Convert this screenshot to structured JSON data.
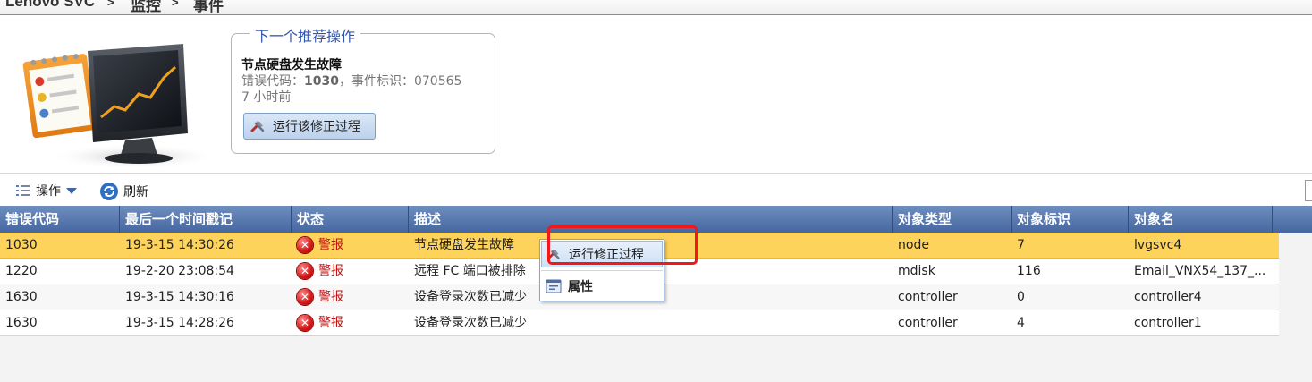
{
  "breadcrumb": {
    "items": [
      "Lenovo SVC",
      "监控",
      "事件"
    ],
    "separator": ">"
  },
  "recommendation": {
    "legend": "下一个推荐操作",
    "title": "节点硬盘发生故障",
    "error_code_label": "错误代码：",
    "error_code": "1030",
    "event_id_label": "，事件标识：",
    "event_id": "070565",
    "time_ago": "7 小时前",
    "run_button_label": "运行该修正过程"
  },
  "toolbar": {
    "actions_label": "操作",
    "refresh_label": "刷新"
  },
  "table": {
    "headers": [
      "错误代码",
      "最后一个时间戳记",
      "状态",
      "描述",
      "对象类型",
      "对象标识",
      "对象名"
    ],
    "rows": [
      {
        "code": "1030",
        "time": "19-3-15 14:30:26",
        "status": "警报",
        "desc": "节点硬盘发生故障",
        "type": "node",
        "id": "7",
        "name": "lvgsvc4"
      },
      {
        "code": "1220",
        "time": "19-2-20 23:08:54",
        "status": "警报",
        "desc": "远程 FC 端口被排除",
        "type": "mdisk",
        "id": "116",
        "name": "Email_VNX54_137_..."
      },
      {
        "code": "1630",
        "time": "19-3-15 14:30:16",
        "status": "警报",
        "desc": "设备登录次数已减少",
        "type": "controller",
        "id": "0",
        "name": "controller4"
      },
      {
        "code": "1630",
        "time": "19-3-15 14:28:26",
        "status": "警报",
        "desc": "设备登录次数已减少",
        "type": "controller",
        "id": "4",
        "name": "controller1"
      }
    ]
  },
  "context_menu": {
    "run_fix_label": "运行修正过程",
    "properties_label": "属性"
  },
  "colors": {
    "header_blue": "#45679f",
    "selected_row": "#fed35b",
    "alert_red": "#d21717",
    "highlight": "#f01818"
  }
}
